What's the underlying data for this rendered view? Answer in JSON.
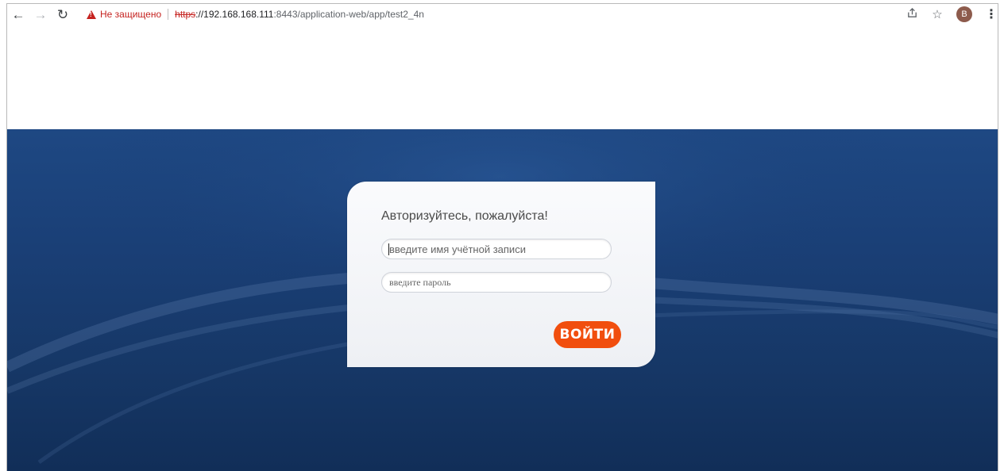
{
  "browser": {
    "security_label": "Не защищено",
    "url_scheme": "https",
    "url_host": "://192.168.168.111",
    "url_path": ":8443/application-web/app/test2_4n",
    "avatar_letter": "B",
    "icons": {
      "back": "arrow-left-icon",
      "forward": "arrow-right-icon",
      "reload": "reload-icon",
      "warning": "warning-triangle-icon",
      "share": "share-icon",
      "bookmark": "star-icon",
      "menu": "kebab-menu-icon"
    }
  },
  "login": {
    "title": "Авторизуйтесь, пожалуйста!",
    "username_placeholder": "введите имя учётной записи",
    "password_placeholder": "введите пароль",
    "submit_label": "ВОЙТИ"
  },
  "colors": {
    "accent": "#f14e0e",
    "background_top": "#1e4883",
    "background_bottom": "#112e58",
    "warning": "#c5221f"
  }
}
